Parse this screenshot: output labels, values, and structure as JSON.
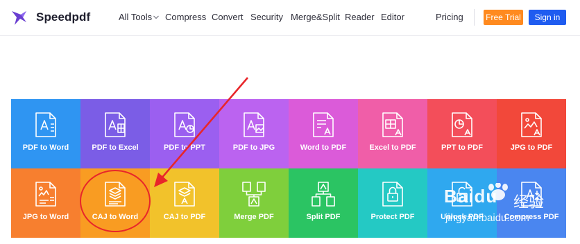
{
  "brand": {
    "name": "Speedpdf",
    "logo_icon": "bird-logo-icon",
    "accent": "#6a3fd1"
  },
  "nav": {
    "items": [
      {
        "label": "All Tools",
        "dropdown": true
      },
      {
        "label": "Compress"
      },
      {
        "label": "Convert"
      },
      {
        "label": "Security"
      },
      {
        "label": "Merge&Split"
      },
      {
        "label": "Reader"
      },
      {
        "label": "Editor"
      }
    ],
    "pricing": "Pricing",
    "free_trial": "Free Trial",
    "sign_in": "Sign in",
    "colors": {
      "free_trial": "#ff8a1f",
      "sign_in": "#1f5cf0"
    }
  },
  "tools": [
    {
      "label": "PDF to Word",
      "color": "#2f95f2",
      "icon": "pdf-doc-icon"
    },
    {
      "label": "PDF to Excel",
      "color": "#7b5de6",
      "icon": "pdf-excel-icon"
    },
    {
      "label": "PDF to PPT",
      "color": "#9b5ff0",
      "icon": "pdf-ppt-icon"
    },
    {
      "label": "PDF to JPG",
      "color": "#bb63f0",
      "icon": "pdf-jpg-icon"
    },
    {
      "label": "Word to PDF",
      "color": "#db5bd9",
      "icon": "doc-pdf-icon"
    },
    {
      "label": "Excel to PDF",
      "color": "#f05ea8",
      "icon": "excel-pdf-icon"
    },
    {
      "label": "PPT to PDF",
      "color": "#f34e5a",
      "icon": "ppt-pdf-icon"
    },
    {
      "label": "JPG to PDF",
      "color": "#f2483a",
      "icon": "jpg-pdf-icon"
    },
    {
      "label": "JPG to Word",
      "color": "#f77f2f",
      "icon": "jpg-word-icon"
    },
    {
      "label": "CAJ to Word",
      "color": "#f99c22",
      "icon": "caj-word-icon"
    },
    {
      "label": "CAJ to PDF",
      "color": "#f2c22b",
      "icon": "caj-pdf-icon"
    },
    {
      "label": "Merge PDF",
      "color": "#7fcf3c",
      "icon": "merge-icon"
    },
    {
      "label": "Split PDF",
      "color": "#2bc463",
      "icon": "split-icon"
    },
    {
      "label": "Protect PDF",
      "color": "#24c9c4",
      "icon": "lock-icon"
    },
    {
      "label": "Unlock PDF",
      "color": "#2fa8ef",
      "icon": "unlock-icon"
    },
    {
      "label": "Compress PDF",
      "color": "#4a86f0",
      "icon": "compress-icon"
    }
  ],
  "annotation": {
    "color": "#e8262a",
    "highlighted_tool": "CAJ to Word"
  },
  "watermark": {
    "brand": "Baidu",
    "cn": "经验",
    "url": "jingyan.baidu.com"
  }
}
